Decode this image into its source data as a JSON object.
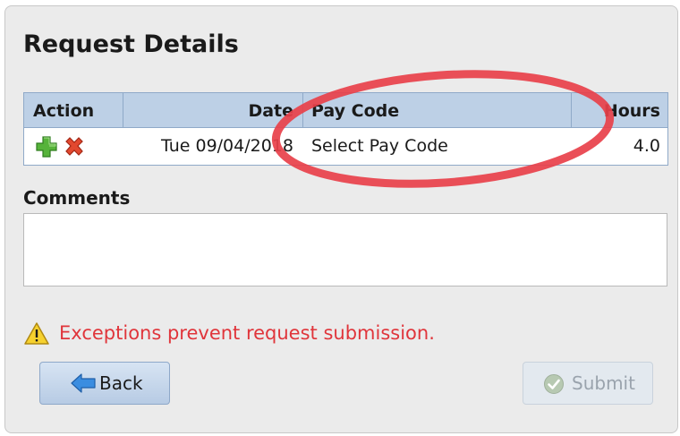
{
  "panel": {
    "title": "Request Details"
  },
  "grid": {
    "headers": {
      "action": "Action",
      "date": "Date",
      "pay_code": "Pay Code",
      "hours": "Hours"
    },
    "rows": [
      {
        "date": "Tue 09/04/2018",
        "pay_code": "Select Pay Code",
        "hours": "4.0",
        "add_icon": "add-plus-icon",
        "delete_icon": "delete-x-icon"
      }
    ]
  },
  "comments": {
    "label": "Comments",
    "value": ""
  },
  "warning": {
    "icon": "warning-triangle-icon",
    "text": "Exceptions prevent request submission."
  },
  "buttons": {
    "back_label": "Back",
    "back_icon": "back-arrow-icon",
    "submit_label": "Submit",
    "submit_icon": "check-circle-icon"
  },
  "annotation": {
    "shape": "ellipse",
    "color": "#e8404a"
  },
  "colors": {
    "header_bg": "#bdd0e6",
    "warning_text": "#e0353b"
  }
}
